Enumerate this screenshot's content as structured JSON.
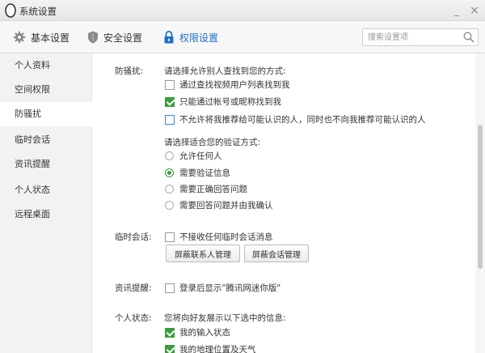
{
  "window": {
    "title": "系统设置",
    "minimize": "_",
    "close": "×"
  },
  "tabs": [
    {
      "label": "基本设置",
      "icon": "gear-icon"
    },
    {
      "label": "安全设置",
      "icon": "shield-icon"
    },
    {
      "label": "权限设置",
      "icon": "lock-icon",
      "active": true
    }
  ],
  "search": {
    "placeholder": "搜索设置项",
    "value": ""
  },
  "sidebar": {
    "items": [
      {
        "label": "个人资料"
      },
      {
        "label": "空间权限"
      },
      {
        "label": "防骚扰",
        "active": true
      },
      {
        "label": "临时会话"
      },
      {
        "label": "资讯提醒"
      },
      {
        "label": "个人状态"
      },
      {
        "label": "远程桌面"
      }
    ]
  },
  "harassment": {
    "label": "防骚扰:",
    "find_prompt": "请选择允许别人查找到您的方式:",
    "find_options": [
      {
        "label": "通过查找视频用户列表找到我",
        "checked": false
      },
      {
        "label": "只能通过帐号或昵称找到我",
        "checked": true
      },
      {
        "label": "不允许将我推荐给可能认识的人，同时也不向我推荐可能认识的人",
        "checked": false
      }
    ],
    "verify_prompt": "请选择适合您的验证方式:",
    "verify_options": [
      {
        "label": "允许任何人",
        "selected": false
      },
      {
        "label": "需要验证信息",
        "selected": true
      },
      {
        "label": "需要正确回答问题",
        "selected": false
      },
      {
        "label": "需要回答问题并由我确认",
        "selected": false
      }
    ]
  },
  "temp_session": {
    "label": "临时会话:",
    "option": {
      "label": "不接收任何临时会话消息",
      "checked": false
    },
    "buttons": [
      "屏蔽联系人管理",
      "屏蔽会话管理"
    ]
  },
  "news": {
    "label": "资讯提醒:",
    "option": {
      "label": "登录后显示\"腾讯网迷你版\"",
      "checked": false
    }
  },
  "status": {
    "label": "个人状态:",
    "prompt": "您将向好友展示以下选中的信息:",
    "options": [
      {
        "label": "我的输入状态",
        "checked": true
      },
      {
        "label": "我的地理位置及天气",
        "checked": true
      }
    ]
  },
  "colors": {
    "accent": "#1e6fc9",
    "check": "#3b9c3b"
  }
}
